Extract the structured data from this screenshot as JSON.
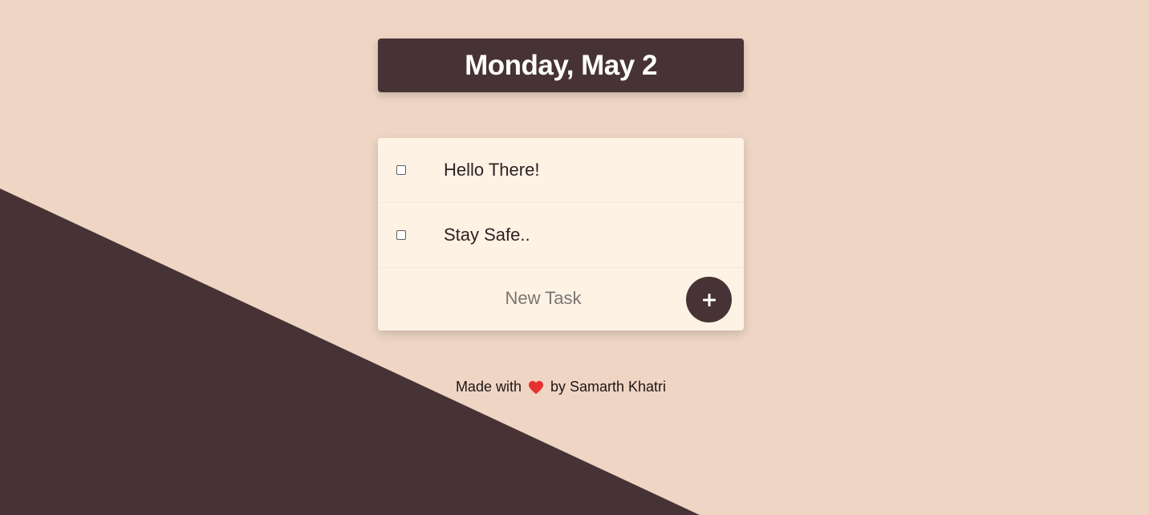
{
  "header": {
    "date": "Monday, May 2"
  },
  "tasks": [
    {
      "label": "Hello There!",
      "checked": false
    },
    {
      "label": "Stay Safe..",
      "checked": false
    }
  ],
  "new_task": {
    "placeholder": "New Task",
    "add_button_label": "+"
  },
  "footer": {
    "made_with": "Made with",
    "by": "by Samarth Khatri"
  },
  "colors": {
    "background": "#eed5c4",
    "accent_dark": "#473335",
    "card": "#fdf2e4",
    "heart": "#e6322e"
  },
  "icons": {
    "heart": "heart-icon",
    "add": "plus-icon"
  }
}
